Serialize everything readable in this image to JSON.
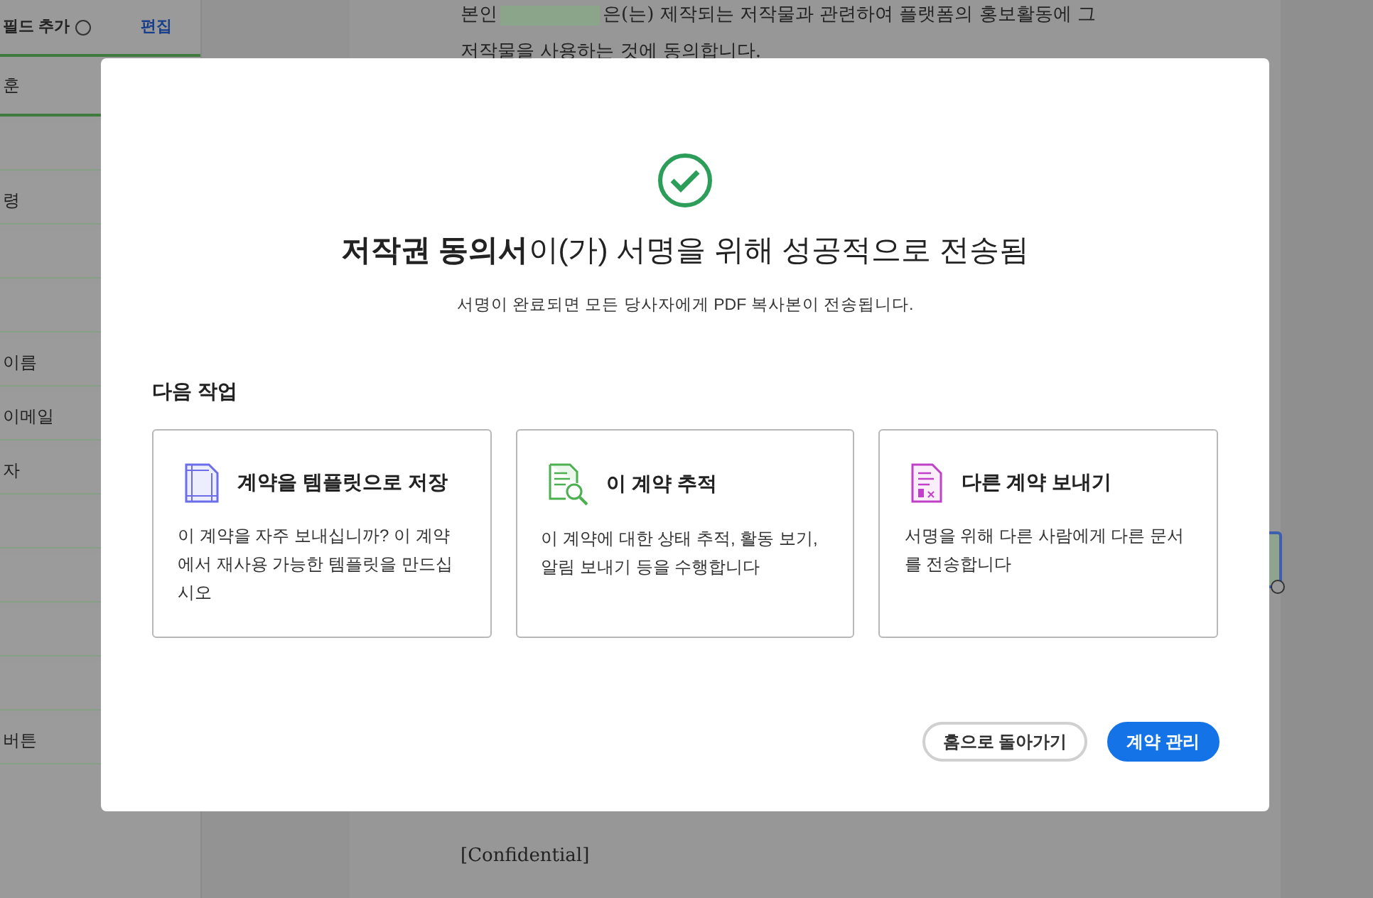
{
  "sidebar": {
    "header": "필드 추가",
    "edit_link": "편집",
    "items": [
      {
        "label": "훈",
        "selected": true
      },
      {
        "selected": false
      },
      {
        "label": "령",
        "selected": false
      },
      {
        "selected": false
      },
      {
        "selected": false
      },
      {
        "label": "이름",
        "selected": false
      },
      {
        "label": "이메일",
        "selected": false
      },
      {
        "label": "자",
        "selected": false
      },
      {
        "selected": false
      },
      {
        "selected": false
      },
      {
        "selected": false
      },
      {
        "selected": false
      },
      {
        "label": "버튼",
        "selected": false
      }
    ]
  },
  "document": {
    "line_1_start": "본인",
    "line_1_end": "은(는) 제작되는 저작물과 관련하여 플랫폼의 홍보활동에 그",
    "line_2": "저작물을 사용하는 것에 동의합니다.",
    "footer": "[Confidential]"
  },
  "dialog": {
    "title": "**저작권 동의서**이(가) 서명을 위해 성공적으로 전송됨",
    "subtitle": "서명이 완료되면 모든 당사자에게 PDF 복사본이 전송됩니다.",
    "section": "다음 작업",
    "cards": [
      {
        "kind": "template",
        "title": "계약을 템플릿으로 저장",
        "text": "이 계약을 자주 보내십니까? 이 계약에서 재사용 가능한 템플릿을 만드십시오"
      },
      {
        "kind": "track",
        "title": "이 계약 추적",
        "text": "이 계약에 대한 상태 추적, 활동 보기, 알림 보내기 등을 수행합니다"
      },
      {
        "kind": "send",
        "title": "다른 계약 보내기",
        "text": "서명을 위해 다른 사람에게 다른 문서를 전송합니다"
      }
    ],
    "buttons": [
      {
        "label": "홈으로 돌아가기",
        "kind": "secondary"
      },
      {
        "label": "계약 관리",
        "kind": "primary"
      }
    ]
  }
}
